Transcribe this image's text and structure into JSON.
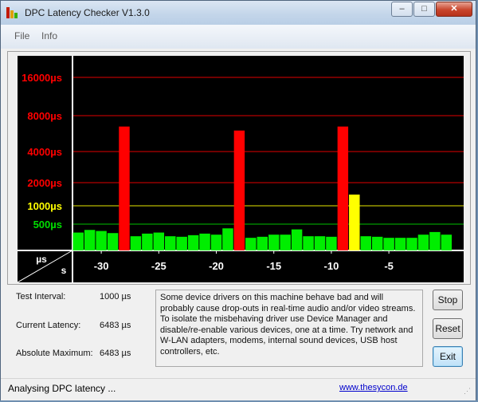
{
  "window": {
    "title": "DPC Latency Checker V1.3.0",
    "minimize_glyph": "–",
    "maximize_glyph": "□",
    "close_glyph": "✕"
  },
  "menu": {
    "items": [
      "File",
      "Info"
    ]
  },
  "chart_data": {
    "type": "bar",
    "y_axis_labels": [
      "16000µs",
      "8000µs",
      "4000µs",
      "2000µs",
      "1000µs",
      "500µs"
    ],
    "y_axis_unit": "µs",
    "x_axis_unit": "s",
    "x_ticks": [
      "-30",
      "-25",
      "-20",
      "-15",
      "-10",
      "-5"
    ],
    "x_range": [
      -32.5,
      1.5
    ],
    "threshold_lines_us": [
      500,
      1000,
      2000,
      4000,
      8000,
      16000
    ],
    "bar_width_s": 1,
    "series": [
      {
        "x": [
          -32,
          -31,
          -30,
          -29,
          -28,
          -27,
          -26,
          -25,
          -24,
          -23,
          -22,
          -21,
          -20,
          -19,
          -18,
          -17,
          -16,
          -15,
          -14,
          -13,
          -12,
          -11,
          -10,
          -9,
          -8,
          -7,
          -6,
          -5,
          -4,
          -3,
          -2,
          -1,
          0
        ],
        "values": [
          340,
          390,
          370,
          330,
          6483,
          270,
          320,
          340,
          270,
          260,
          290,
          320,
          300,
          420,
          6000,
          240,
          260,
          300,
          300,
          400,
          270,
          270,
          260,
          6483,
          1400,
          270,
          260,
          240,
          240,
          240,
          300,
          350,
          300
        ]
      }
    ],
    "colors": {
      "normal": "#00ee00",
      "warning": "#ffff00",
      "danger": "#ff0000"
    }
  },
  "info": {
    "test_interval_label": "Test Interval:",
    "test_interval_value": "1000 µs",
    "current_latency_label": "Current Latency:",
    "current_latency_value": "6483 µs",
    "absolute_maximum_label": "Absolute Maximum:",
    "absolute_maximum_value": "6483 µs"
  },
  "description": "Some device drivers on this machine behave bad and will probably cause drop-outs in real-time audio and/or video streams. To isolate the misbehaving driver use Device Manager and disable/re-enable various devices, one at a time. Try network and W-LAN adapters, modems, internal sound devices, USB host controllers, etc.",
  "buttons": {
    "stop": "Stop",
    "reset": "Reset",
    "exit": "Exit"
  },
  "status": {
    "text": "Analysing DPC latency ...",
    "link": "www.thesycon.de",
    "grip": "⋰"
  }
}
